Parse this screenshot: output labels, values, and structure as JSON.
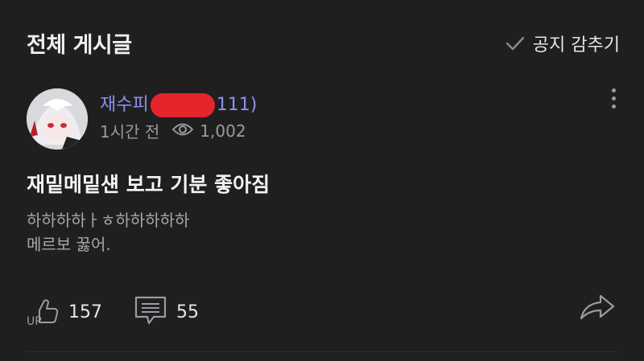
{
  "header": {
    "title": "전체 게시글",
    "notice_toggle_label": "공지 감추기"
  },
  "post": {
    "author_prefix": "재수피",
    "author_suffix": "111)",
    "time": "1시간 전",
    "views": "1,002",
    "title": "재밑메밑섄 보고 기분 좋아짐",
    "body_line1": "하하하하ㅏㅎ하하하하하",
    "body_line2": "메르보 꿇어.",
    "likes": "157",
    "like_badge": "UP",
    "comments": "55"
  }
}
